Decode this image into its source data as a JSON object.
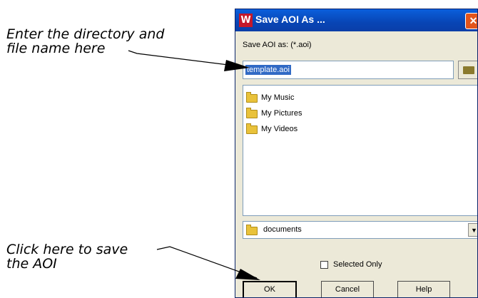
{
  "callouts": {
    "filename": {
      "line1": "Enter the directory and",
      "line2": "file name here"
    },
    "ok": {
      "line1": "Click here to save",
      "line2": "the AOI"
    }
  },
  "dialog": {
    "title": "Save AOI As ...",
    "app_icon": "W",
    "close_glyph": "✕",
    "save_label": "Save AOI as: (*.aoi)",
    "filename_value": "template.aoi",
    "files": [
      {
        "name": "My Music",
        "icon": "folder-icon"
      },
      {
        "name": "My Pictures",
        "icon": "folder-icon"
      },
      {
        "name": "My Videos",
        "icon": "folder-icon"
      }
    ],
    "directory": "documents",
    "dropdown_glyph": "▼",
    "selected_only": {
      "label": "Selected Only",
      "checked": false
    },
    "buttons": {
      "ok": "OK",
      "cancel": "Cancel",
      "help": "Help"
    }
  }
}
